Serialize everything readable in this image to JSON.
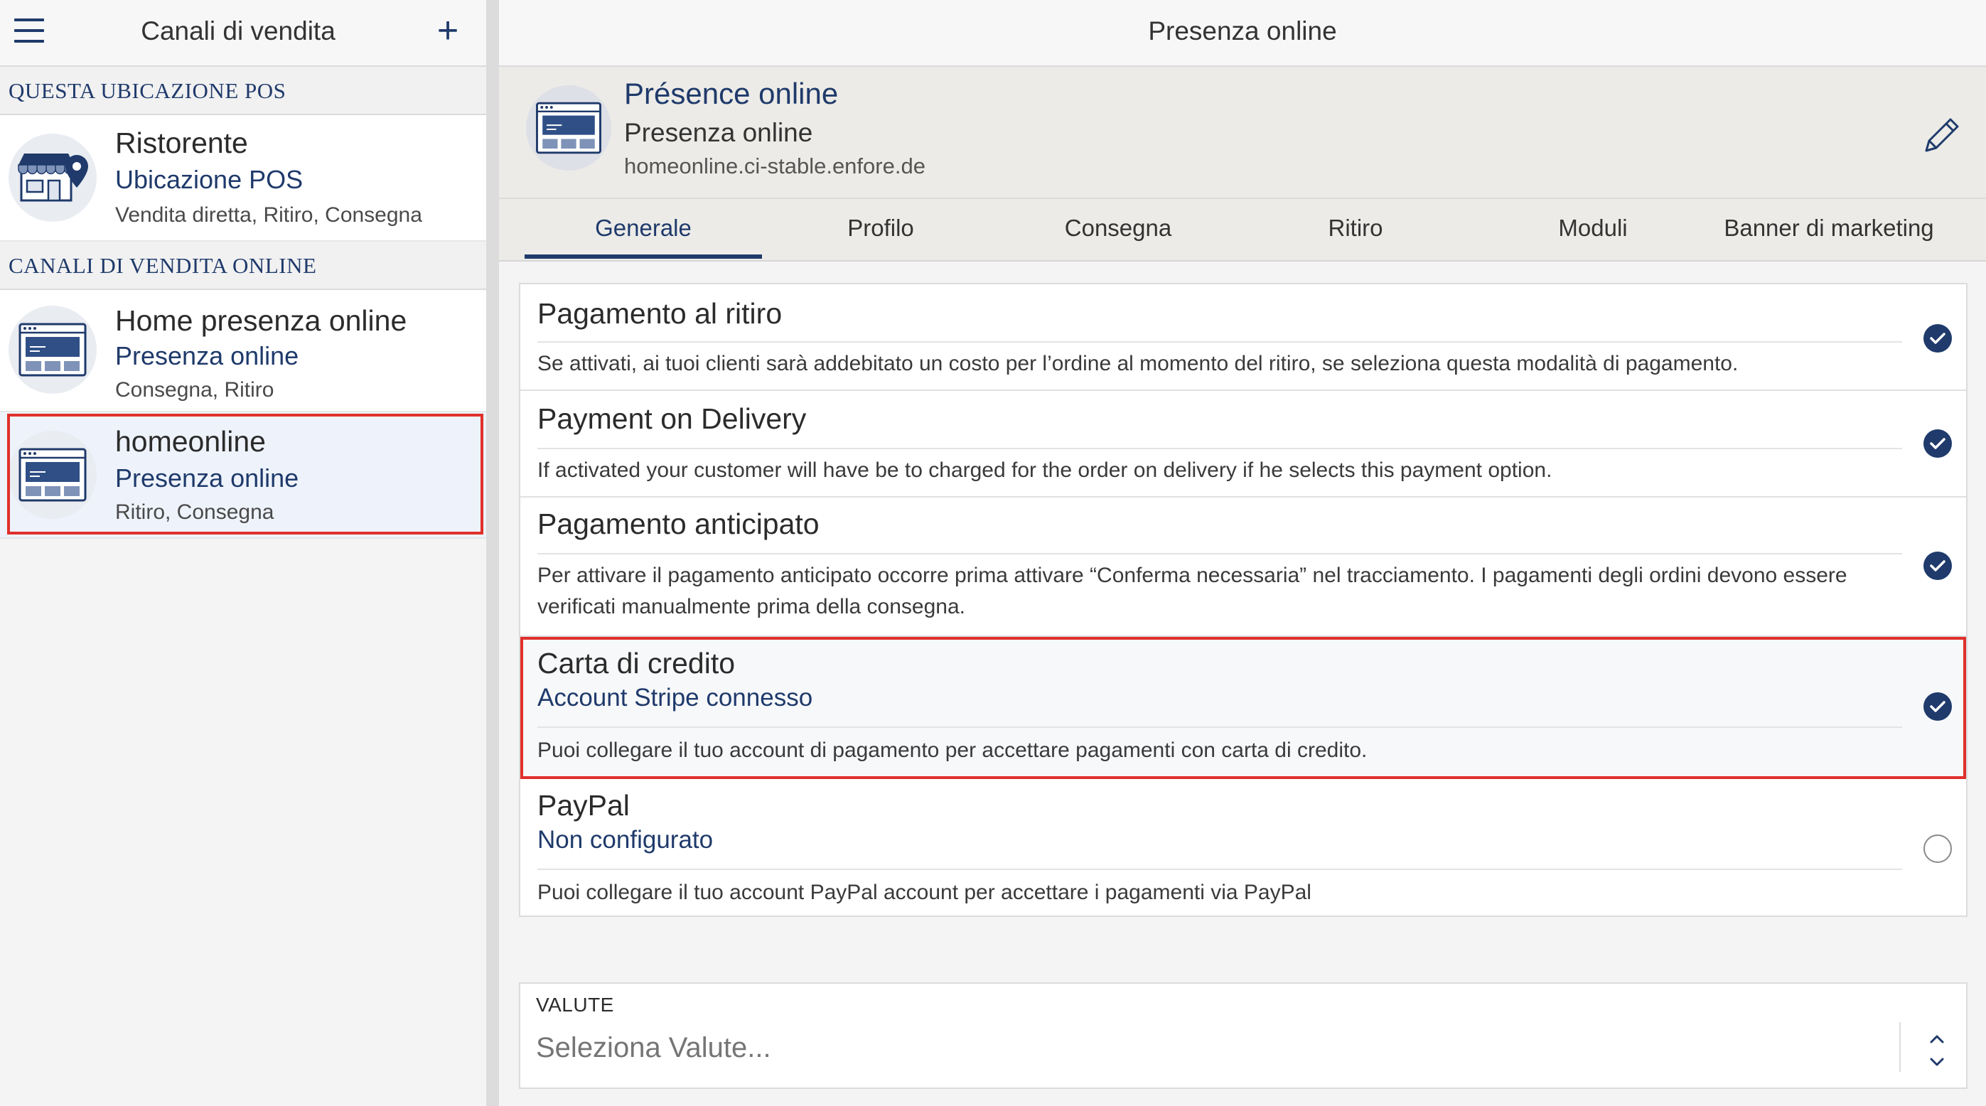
{
  "left": {
    "title": "Canali di vendita",
    "add_label": "+",
    "section_pos": "QUESTA UBICAZIONE POS",
    "section_online": "CANALI DI VENDITA ONLINE",
    "channels": [
      {
        "name": "Ristorente",
        "type": "Ubicazione POS",
        "sub": "Vendita diretta, Ritiro, Consegna",
        "icon": "store-location-icon"
      },
      {
        "name": "Home presenza online",
        "type": "Presenza online",
        "sub": "Consegna, Ritiro",
        "icon": "browser-window-icon"
      },
      {
        "name": "homeonline",
        "type": "Presenza online",
        "sub": "Ritiro, Consegna",
        "icon": "browser-window-icon",
        "selected": true
      }
    ]
  },
  "right": {
    "topbar_title": "Presenza online",
    "info": {
      "title": "Présence online",
      "subtitle": "Presenza online",
      "url": "homeonline.ci-stable.enfore.de"
    },
    "tabs": [
      "Generale",
      "Profilo",
      "Consegna",
      "Ritiro",
      "Moduli",
      "Banner di marketing"
    ],
    "active_tab": "Generale",
    "payments": [
      {
        "title": "Pagamento al ritiro",
        "status": "",
        "desc": "Se attivati, ai tuoi clienti sarà addebitato un costo per l’ordine al momento del ritiro, se seleziona questa modalità di pagamento.",
        "checked": true
      },
      {
        "title": "Payment on Delivery",
        "status": "",
        "desc": "If activated your customer will have be to charged for the order on delivery if he selects this payment option.",
        "checked": true
      },
      {
        "title": "Pagamento anticipato",
        "status": "",
        "desc": "Per attivare il pagamento anticipato occorre prima attivare “Conferma necessaria” nel tracciamento. I pagamenti degli ordini devono essere verificati manualmente prima della consegna.",
        "checked": true
      },
      {
        "title": "Carta di credito",
        "status": "Account Stripe connesso",
        "desc": "Puoi collegare il tuo account di pagamento per accettare pagamenti con carta di credito.",
        "checked": true
      },
      {
        "title": "PayPal",
        "status": "Non configurato",
        "desc": "Puoi collegare il tuo account PayPal account per accettare i pagamenti via PayPal",
        "checked": false
      }
    ],
    "valute": {
      "label": "VALUTE",
      "placeholder": "Seleziona Valute..."
    }
  },
  "colors": {
    "accent": "#1f3a6b",
    "highlight": "#e0302b"
  }
}
